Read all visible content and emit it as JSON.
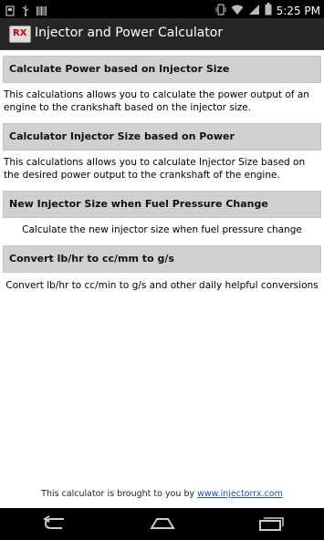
{
  "status_bar": {
    "time": "5:25",
    "time_suffix": "PM",
    "icons": [
      "storage-icon",
      "usb-icon",
      "barcode-icon",
      "vibrate-icon",
      "wifi-icon",
      "signal-icon",
      "battery-icon"
    ]
  },
  "app": {
    "title": "Injector and Power Calculator"
  },
  "sections": [
    {
      "header": "Calculate Power based on Injector Size",
      "description": "This calculations allows you to calculate the power output of an engine to the crankshaft based on the injector size."
    },
    {
      "header": "Calculator Injector Size based on Power",
      "description": "This calculations allows you to calculate Injector Size based on the desired power output to the crankshaft of the engine."
    },
    {
      "header": "New Injector Size when Fuel Pressure Change",
      "description": "Calculate the new injector size when fuel pressure change"
    },
    {
      "header": "Convert lb/hr to cc/mm to g/s",
      "description": "Convert lb/hr to cc/min to g/s and other daily helpful conversions"
    }
  ],
  "footer": {
    "text": "This calculator is brought to you by",
    "link": "www.injectorrx.com"
  },
  "colors": {
    "header_bg": "#d0d0d0",
    "titlebar_bg": "#262626",
    "link": "#1a4fd6"
  }
}
